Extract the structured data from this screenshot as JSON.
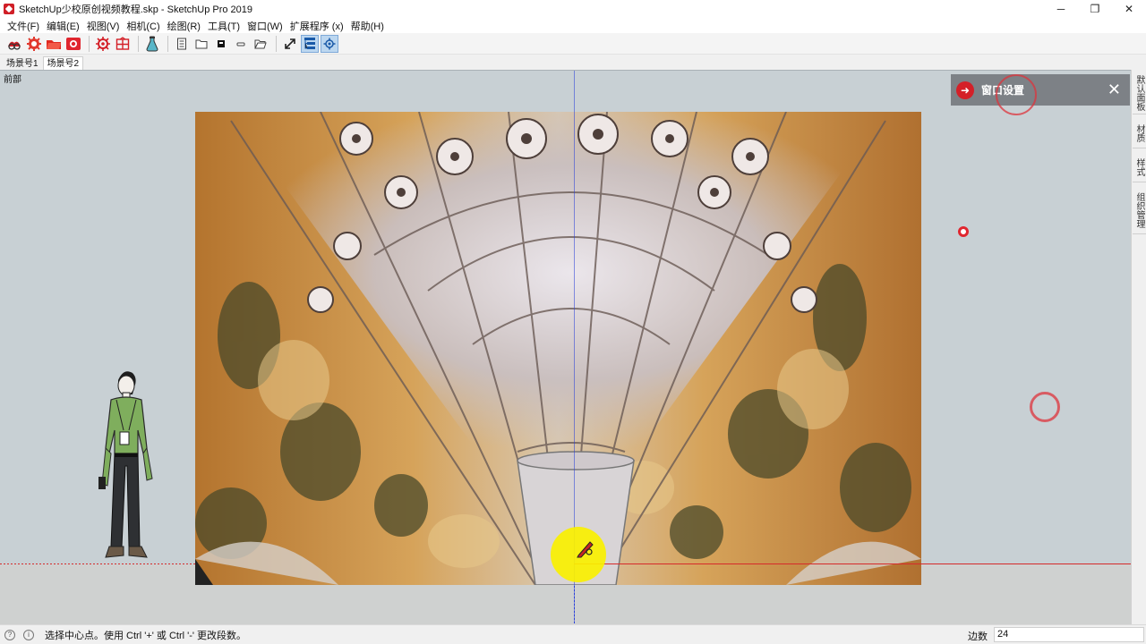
{
  "window": {
    "title": "SketchUp少校原创视频教程.skp - SketchUp Pro 2019",
    "minimize": "─",
    "restore": "❐",
    "close": "✕"
  },
  "menu": [
    {
      "label": "文件(F)"
    },
    {
      "label": "编辑(E)"
    },
    {
      "label": "视图(V)"
    },
    {
      "label": "相机(C)"
    },
    {
      "label": "绘图(R)"
    },
    {
      "label": "工具(T)"
    },
    {
      "label": "窗口(W)"
    },
    {
      "label": "扩展程序 (x)"
    },
    {
      "label": "帮助(H)"
    }
  ],
  "toolbar": {
    "icons": [
      "3d-warehouse-icon",
      "extension-manager-icon",
      "open-folder-icon",
      "camera-icon",
      "settings-gear-icon",
      "component-grid-icon",
      "flask-icon",
      "document-icon",
      "folder-icon",
      "black-square-icon",
      "dash-icon",
      "open-folder-outline-icon",
      "diagonal-arrow-icon",
      "outliner-icon",
      "small-gear-icon"
    ]
  },
  "scenes": {
    "tabs": [
      {
        "label": "场景号1",
        "active": false
      },
      {
        "label": "场景号2",
        "active": true
      }
    ]
  },
  "viewport": {
    "view_name": "前部"
  },
  "panel": {
    "title": "窗口设置",
    "icon": "arrow-right-icon",
    "close": "✕"
  },
  "tray": {
    "tabs": [
      {
        "label": "默认面板"
      },
      {
        "label": "材质"
      },
      {
        "label": "样式"
      },
      {
        "label": "组织管理"
      }
    ]
  },
  "status": {
    "text": "选择中心点。使用 Ctrl '+' 或 Ctrl '-' 更改段数。",
    "measure_label": "边数",
    "measure_value": "24"
  },
  "colors": {
    "accent_red": "#d42028",
    "axis_red": "#d62a2a",
    "axis_blue": "#2a3fd8",
    "sky": "#c8d0d4",
    "cursor_highlight": "#faf000"
  }
}
